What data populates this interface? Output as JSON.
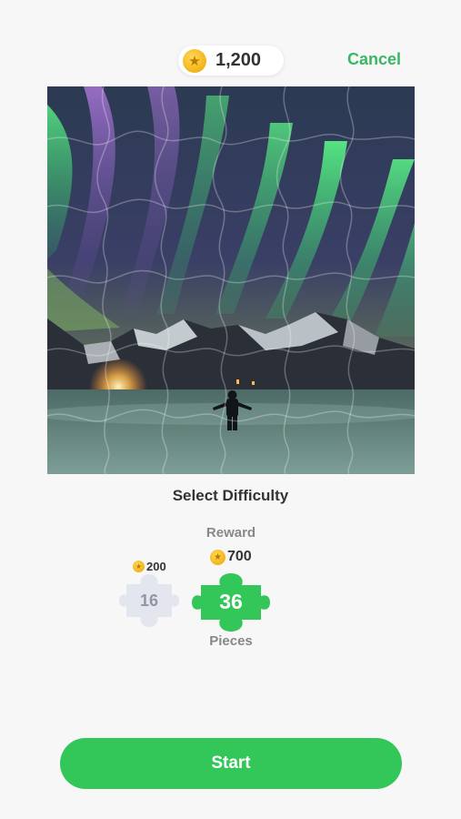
{
  "header": {
    "coin_balance": "1,200",
    "cancel_label": "Cancel"
  },
  "puzzle": {
    "image_subject": "aurora-borealis-over-snowy-mountains"
  },
  "difficulty": {
    "title": "Select Difficulty",
    "reward_label": "Reward",
    "pieces_label": "Pieces",
    "options": [
      {
        "pieces": "16",
        "reward": "200",
        "selected": false
      },
      {
        "pieces": "36",
        "reward": "700",
        "selected": true
      }
    ]
  },
  "actions": {
    "start_label": "Start"
  },
  "colors": {
    "accent": "#33c759",
    "cancel": "#38b862",
    "coin": "#f3b417",
    "unselected_piece": "#e3e6ee"
  }
}
